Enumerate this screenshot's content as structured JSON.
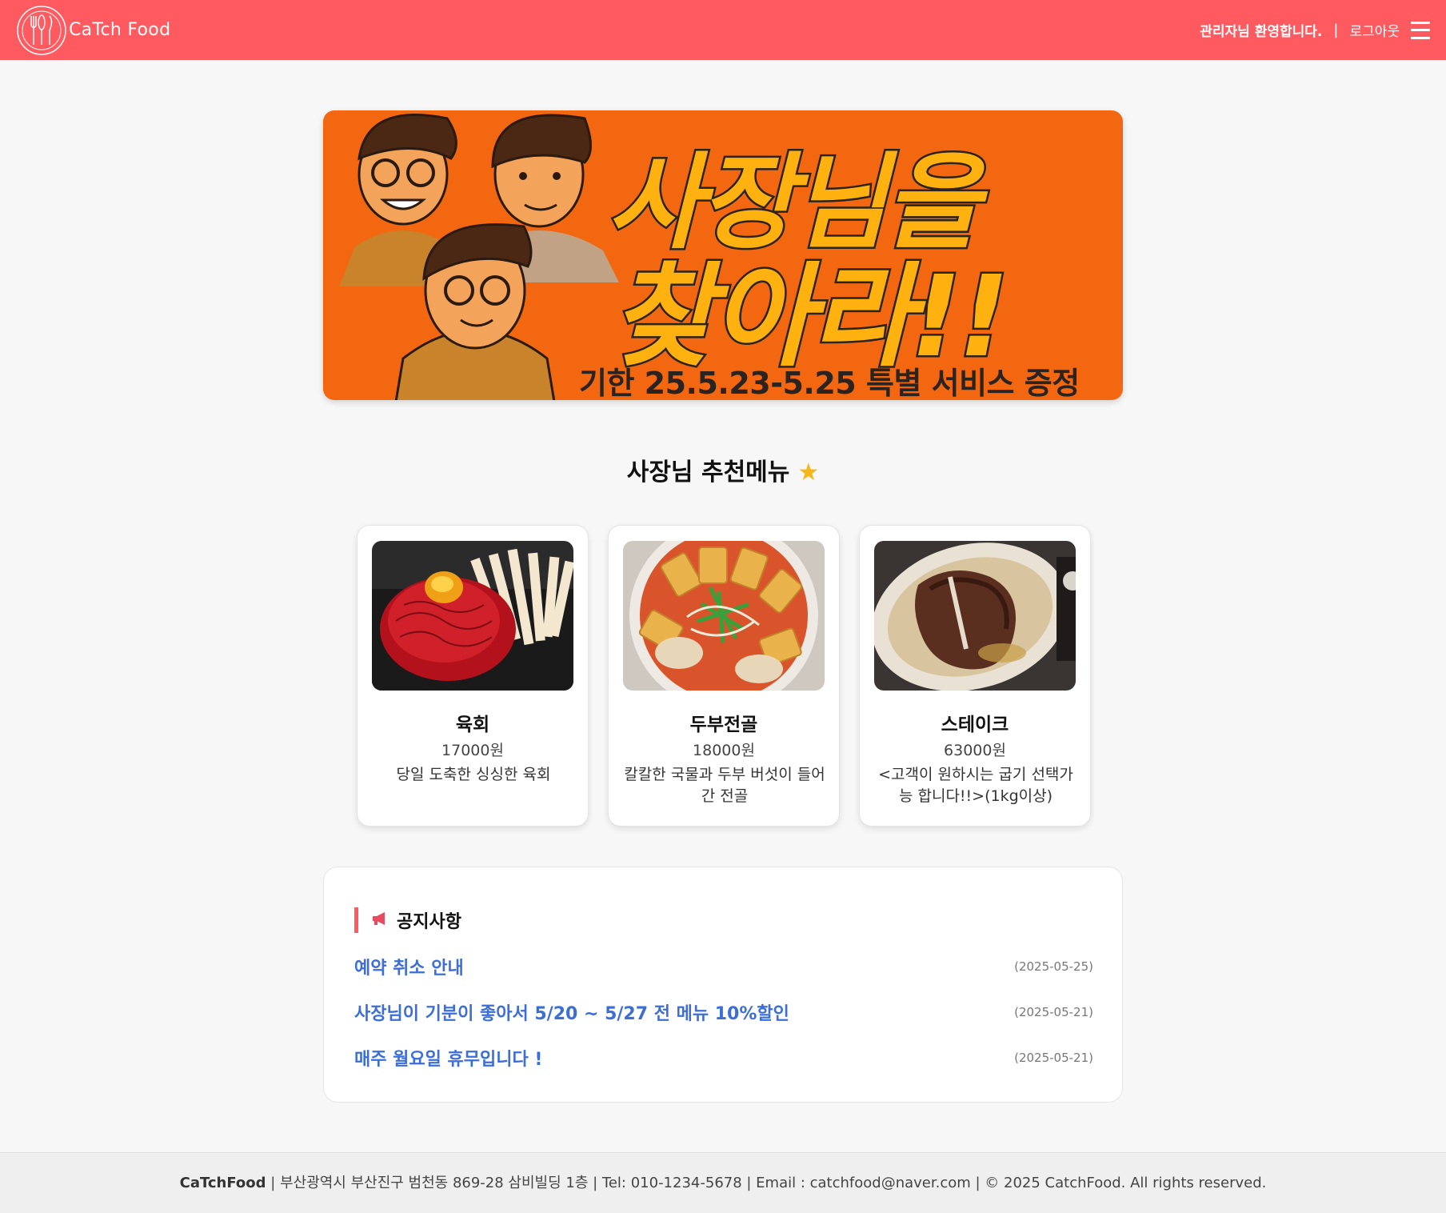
{
  "header": {
    "brand": "CaTch Food",
    "welcome": "관리자님 환영합니다.",
    "separator": "|",
    "logout": "로그아웃"
  },
  "banner": {
    "line1": "사장님을",
    "line2": "찾아라!!",
    "subtitle": "기한 25.5.23-5.25 특별 서비스 증정"
  },
  "recommend": {
    "title": "사장님 추천메뉴",
    "star": "★",
    "items": [
      {
        "name": "육회",
        "price": "17000원",
        "desc": "당일 도축한 싱싱한 육회"
      },
      {
        "name": "두부전골",
        "price": "18000원",
        "desc": "칼칼한 국물과 두부 버섯이 들어간 전골"
      },
      {
        "name": "스테이크",
        "price": "63000원",
        "desc": "<고객이 원하시는 굽기 선택가능 합니다!!>(1kg이상)"
      }
    ]
  },
  "notice": {
    "title": "공지사항",
    "items": [
      {
        "title": "예약 취소 안내",
        "date": "(2025-05-25)"
      },
      {
        "title": "사장님이 기분이 좋아서 5/20 ~ 5/27 전 메뉴 10%할인",
        "date": "(2025-05-21)"
      },
      {
        "title": "매주 월요일 휴무입니다 !",
        "date": "(2025-05-21)"
      }
    ]
  },
  "footer": {
    "brand": "CaTchFood",
    "text": " | 부산광역시 부산진구 범천동 869-28 삼비빌딩 1층 | Tel: 010-1234-5678 | Email : catchfood@naver.com | © 2025 CatchFood. All rights reserved."
  },
  "colors": {
    "header": "#ff5a5f",
    "banner": "#f2670f",
    "banner_text": "#ffb20f",
    "link": "#3b6ed8"
  }
}
